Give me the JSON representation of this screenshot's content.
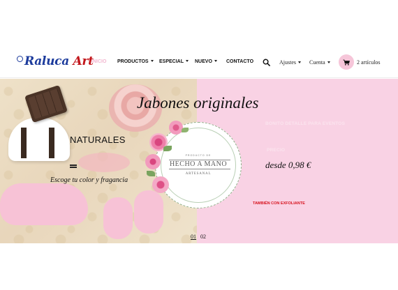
{
  "header": {
    "logo": {
      "part1": "Raluca",
      "part2": "Art"
    },
    "nav": [
      {
        "label": "INICIO",
        "active": true,
        "dropdown": false
      },
      {
        "label": "PRODUCTOS",
        "active": false,
        "dropdown": true
      },
      {
        "label": "ESPECIAL",
        "active": false,
        "dropdown": true
      },
      {
        "label": "NUEVO",
        "active": false,
        "dropdown": true
      },
      {
        "label": "CONTACTO",
        "active": false,
        "dropdown": false
      }
    ],
    "settings_label": "Ajustes",
    "account_label": "Cuenta",
    "cart_label": "2 artículos"
  },
  "hero": {
    "title": "Jabones originales",
    "left_heading": "NATURALES",
    "left_caption": "Escoge tu color y fragancia",
    "badge": {
      "top": "PRODUCTO DE",
      "main": "HECHO A MANO",
      "sub": "ARTESANAL"
    },
    "right_tagline": "BONITO DETALLE PARA EVENTOS",
    "price_label": "PRECIO",
    "price_value": "desde 0,98 €",
    "extra_note": "TAMBIÉN CON EXFOLIANTE",
    "pager": [
      "01",
      "02"
    ],
    "active_slide": "01"
  },
  "colors": {
    "accent_pink": "#f6c6d9",
    "hero_right_bg": "#f9d2e4",
    "logo_blue": "#1c3b9c",
    "logo_red": "#c2161b",
    "note_red": "#d7131e"
  },
  "icons": [
    "search-icon",
    "cart-icon",
    "chevron-down-icon"
  ]
}
